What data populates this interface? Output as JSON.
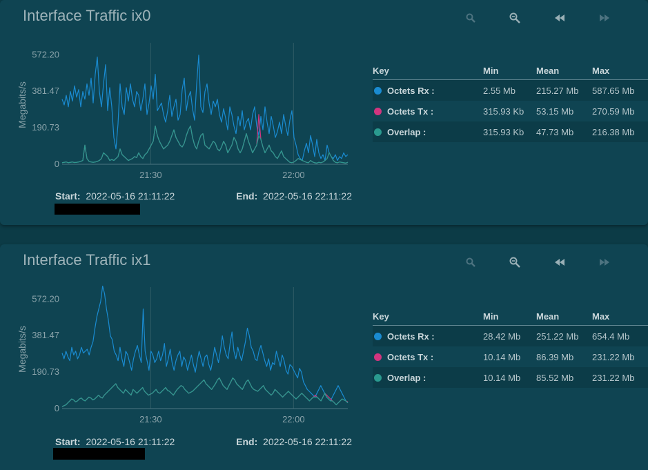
{
  "colors": {
    "rx": "#1a8bd1",
    "tx": "#d2357f",
    "overlap": "#2a9a8f"
  },
  "icons": {
    "zoom_in": "zoom-in-icon",
    "zoom_out": "zoom-out-icon",
    "back": "rewind-icon",
    "forward": "fast-forward-icon"
  },
  "panels": [
    {
      "title": "Interface Traffic ix0",
      "start_label": "Start:",
      "start_value": "2022-05-16 21:11:22",
      "end_label": "End:",
      "end_value": "2022-05-16 22:11:22",
      "legend": {
        "headers": [
          "Key",
          "Min",
          "Mean",
          "Max"
        ],
        "rows": [
          {
            "key": "Octets Rx :",
            "min": "2.55 Mb",
            "mean": "215.27 Mb",
            "max": "587.65 Mb"
          },
          {
            "key": "Octets Tx :",
            "min": "315.93 Kb",
            "mean": "53.15 Mb",
            "max": "270.59 Mb"
          },
          {
            "key": "Overlap :",
            "min": "315.93 Kb",
            "mean": "47.73 Mb",
            "max": "216.38 Mb"
          }
        ]
      }
    },
    {
      "title": "Interface Traffic ix1",
      "start_label": "Start:",
      "start_value": "2022-05-16 21:11:22",
      "end_label": "End:",
      "end_value": "2022-05-16 22:11:22",
      "legend": {
        "headers": [
          "Key",
          "Min",
          "Mean",
          "Max"
        ],
        "rows": [
          {
            "key": "Octets Rx :",
            "min": "28.42 Mb",
            "mean": "251.22 Mb",
            "max": "654.4 Mb"
          },
          {
            "key": "Octets Tx :",
            "min": "10.14 Mb",
            "mean": "86.39 Mb",
            "max": "231.22 Mb"
          },
          {
            "key": "Overlap :",
            "min": "10.14 Mb",
            "mean": "85.52 Mb",
            "max": "231.22 Mb"
          }
        ]
      }
    }
  ],
  "chart_data": [
    {
      "type": "line",
      "ylabel": "Megabits/s",
      "yticks": [
        "0",
        "190.73",
        "381.47",
        "572.20"
      ],
      "ytick_values": [
        0,
        190.73,
        381.47,
        572.2
      ],
      "xticks": [
        "21:30",
        "22:00"
      ],
      "xtick_minutes": [
        18.6,
        48.6
      ],
      "x_range_minutes": [
        0,
        60
      ],
      "ylim": [
        0,
        620
      ],
      "series": [
        {
          "name": "Octets Rx",
          "values": [
            340,
            310,
            360,
            300,
            380,
            330,
            410,
            350,
            390,
            300,
            380,
            340,
            420,
            360,
            450,
            320,
            470,
            560,
            380,
            300,
            420,
            520,
            280,
            400,
            300,
            140,
            80,
            210,
            420,
            300,
            260,
            400,
            330,
            420,
            340,
            300,
            380,
            360,
            280,
            340,
            420,
            260,
            320,
            410,
            340,
            470,
            280,
            300,
            320,
            260,
            220,
            280,
            360,
            250,
            300,
            340,
            230,
            260,
            390,
            450,
            280,
            350,
            380,
            290,
            230,
            420,
            570,
            300,
            270,
            380,
            420,
            320,
            260,
            330,
            300,
            340,
            260,
            220,
            290,
            240,
            180,
            300,
            260,
            200,
            160,
            250,
            200,
            280,
            180,
            220,
            240,
            180,
            260,
            300,
            200,
            150,
            250,
            180,
            300,
            220,
            160,
            250,
            200,
            140,
            170,
            220,
            160,
            260,
            200,
            150,
            230,
            280,
            140,
            100,
            50,
            30,
            20,
            70,
            110,
            60,
            150,
            100,
            40,
            130,
            60,
            30,
            50,
            20,
            100,
            60,
            40,
            30,
            50,
            20,
            40,
            30,
            60,
            40,
            50
          ]
        },
        {
          "name": "Octets Tx",
          "values": [
            8,
            10,
            12,
            8,
            10,
            12,
            9,
            10,
            12,
            15,
            20,
            100,
            30,
            15,
            12,
            10,
            12,
            15,
            20,
            30,
            60,
            50,
            40,
            20,
            25,
            20,
            30,
            40,
            80,
            50,
            40,
            30,
            20,
            25,
            30,
            40,
            35,
            60,
            40,
            30,
            50,
            60,
            80,
            100,
            120,
            200,
            150,
            120,
            100,
            80,
            90,
            100,
            120,
            150,
            180,
            140,
            120,
            100,
            90,
            110,
            150,
            180,
            200,
            140,
            100,
            80,
            120,
            150,
            160,
            100,
            90,
            80,
            100,
            120,
            110,
            80,
            70,
            90,
            120,
            100,
            60,
            80,
            100,
            140,
            120,
            80,
            60,
            80,
            120,
            160,
            120,
            90,
            60,
            80,
            100,
            260,
            130,
            90,
            60,
            80,
            100,
            70,
            60,
            40,
            30,
            50,
            70,
            40,
            30,
            20,
            10,
            8,
            12,
            20,
            30,
            25,
            20,
            15,
            10,
            8,
            20,
            12,
            8,
            6,
            10,
            8,
            12,
            20,
            30,
            60,
            40,
            20,
            10,
            8,
            12,
            10,
            8,
            6,
            10
          ]
        }
      ]
    },
    {
      "type": "line",
      "ylabel": "Megabits/s",
      "yticks": [
        "0",
        "190.73",
        "381.47",
        "572.20"
      ],
      "ytick_values": [
        0,
        190.73,
        381.47,
        572.2
      ],
      "xticks": [
        "21:30",
        "22:00"
      ],
      "xtick_minutes": [
        18.6,
        48.6
      ],
      "x_range_minutes": [
        0,
        60
      ],
      "ylim": [
        0,
        620
      ],
      "series": [
        {
          "name": "Octets Rx",
          "values": [
            290,
            260,
            300,
            270,
            250,
            320,
            280,
            300,
            260,
            280,
            320,
            290,
            300,
            310,
            280,
            320,
            350,
            420,
            480,
            520,
            560,
            640,
            600,
            520,
            460,
            380,
            360,
            300,
            280,
            250,
            320,
            260,
            220,
            300,
            280,
            240,
            200,
            260,
            300,
            330,
            280,
            240,
            520,
            300,
            250,
            200,
            300,
            280,
            240,
            260,
            300,
            250,
            280,
            340,
            220,
            260,
            310,
            240,
            200,
            250,
            280,
            300,
            220,
            270,
            250,
            200,
            240,
            280,
            230,
            190,
            250,
            300,
            260,
            220,
            270,
            280,
            230,
            200,
            250,
            320,
            280,
            240,
            300,
            380,
            320,
            280,
            260,
            340,
            400,
            300,
            260,
            320,
            280,
            250,
            300,
            350,
            420,
            380,
            320,
            300,
            260,
            250,
            300,
            330,
            290,
            250,
            220,
            260,
            200,
            240,
            230,
            300,
            260,
            220,
            280,
            250,
            200,
            180,
            230,
            220,
            200,
            180,
            160,
            210,
            190,
            140,
            120,
            100,
            90,
            80,
            70,
            60,
            80,
            100,
            120,
            100,
            80,
            60,
            50,
            40,
            60,
            80,
            100,
            120,
            100,
            80,
            60,
            40,
            30
          ]
        },
        {
          "name": "Octets Tx",
          "values": [
            10,
            15,
            20,
            30,
            40,
            50,
            45,
            35,
            40,
            50,
            55,
            45,
            40,
            50,
            60,
            55,
            45,
            50,
            60,
            70,
            60,
            55,
            70,
            80,
            90,
            100,
            110,
            120,
            130,
            110,
            100,
            90,
            80,
            100,
            90,
            80,
            70,
            100,
            90,
            80,
            90,
            100,
            110,
            90,
            80,
            70,
            75,
            80,
            90,
            100,
            85,
            80,
            90,
            100,
            110,
            95,
            90,
            80,
            70,
            85,
            100,
            110,
            120,
            115,
            100,
            90,
            80,
            85,
            90,
            100,
            110,
            120,
            130,
            140,
            150,
            130,
            120,
            110,
            100,
            115,
            130,
            150,
            160,
            140,
            120,
            110,
            100,
            120,
            140,
            160,
            150,
            130,
            120,
            110,
            100,
            120,
            140,
            150,
            130,
            110,
            100,
            95,
            90,
            100,
            110,
            120,
            100,
            90,
            80,
            70,
            80,
            100,
            90,
            80,
            70,
            60,
            70,
            80,
            90,
            80,
            70,
            60,
            50,
            60,
            70,
            80,
            70,
            60,
            50,
            40,
            50,
            60,
            70,
            60,
            50,
            40,
            60,
            80,
            70,
            60,
            50,
            40,
            30,
            20,
            30,
            40,
            50,
            45,
            40,
            35
          ]
        }
      ]
    }
  ]
}
